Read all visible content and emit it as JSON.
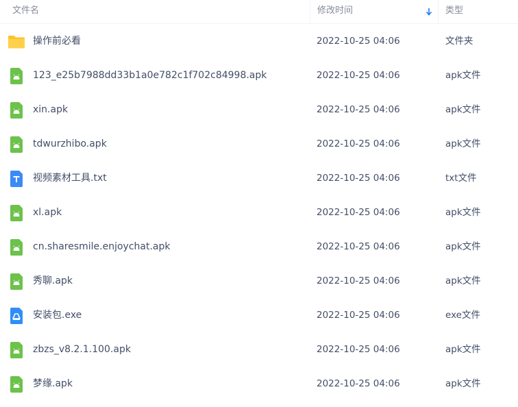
{
  "header": {
    "name_label": "文件名",
    "time_label": "修改时间",
    "type_label": "类型",
    "sort_icon": "sort-down-arrow-icon",
    "accent_color": "#1a7cf5"
  },
  "files": [
    {
      "name": "操作前必看",
      "time": "2022-10-25 04:06",
      "type": "文件夹",
      "icon": "folder-icon"
    },
    {
      "name": "123_e25b7988dd33b1a0e782c1f702c84998.apk",
      "time": "2022-10-25 04:06",
      "type": "apk文件",
      "icon": "apk-icon"
    },
    {
      "name": "xin.apk",
      "time": "2022-10-25 04:06",
      "type": "apk文件",
      "icon": "apk-icon"
    },
    {
      "name": "tdwurzhibo.apk",
      "time": "2022-10-25 04:06",
      "type": "apk文件",
      "icon": "apk-icon"
    },
    {
      "name": "视频素材工具.txt",
      "time": "2022-10-25 04:06",
      "type": "txt文件",
      "icon": "txt-icon"
    },
    {
      "name": "xl.apk",
      "time": "2022-10-25 04:06",
      "type": "apk文件",
      "icon": "apk-icon"
    },
    {
      "name": "cn.sharesmile.enjoychat.apk",
      "time": "2022-10-25 04:06",
      "type": "apk文件",
      "icon": "apk-icon"
    },
    {
      "name": "秀聊.apk",
      "time": "2022-10-25 04:06",
      "type": "apk文件",
      "icon": "apk-icon"
    },
    {
      "name": "安装包.exe",
      "time": "2022-10-25 04:06",
      "type": "exe文件",
      "icon": "exe-icon"
    },
    {
      "name": "zbzs_v8.2.1.100.apk",
      "time": "2022-10-25 04:06",
      "type": "apk文件",
      "icon": "apk-icon"
    },
    {
      "name": "梦缘.apk",
      "time": "2022-10-25 04:06",
      "type": "apk文件",
      "icon": "apk-icon"
    }
  ]
}
